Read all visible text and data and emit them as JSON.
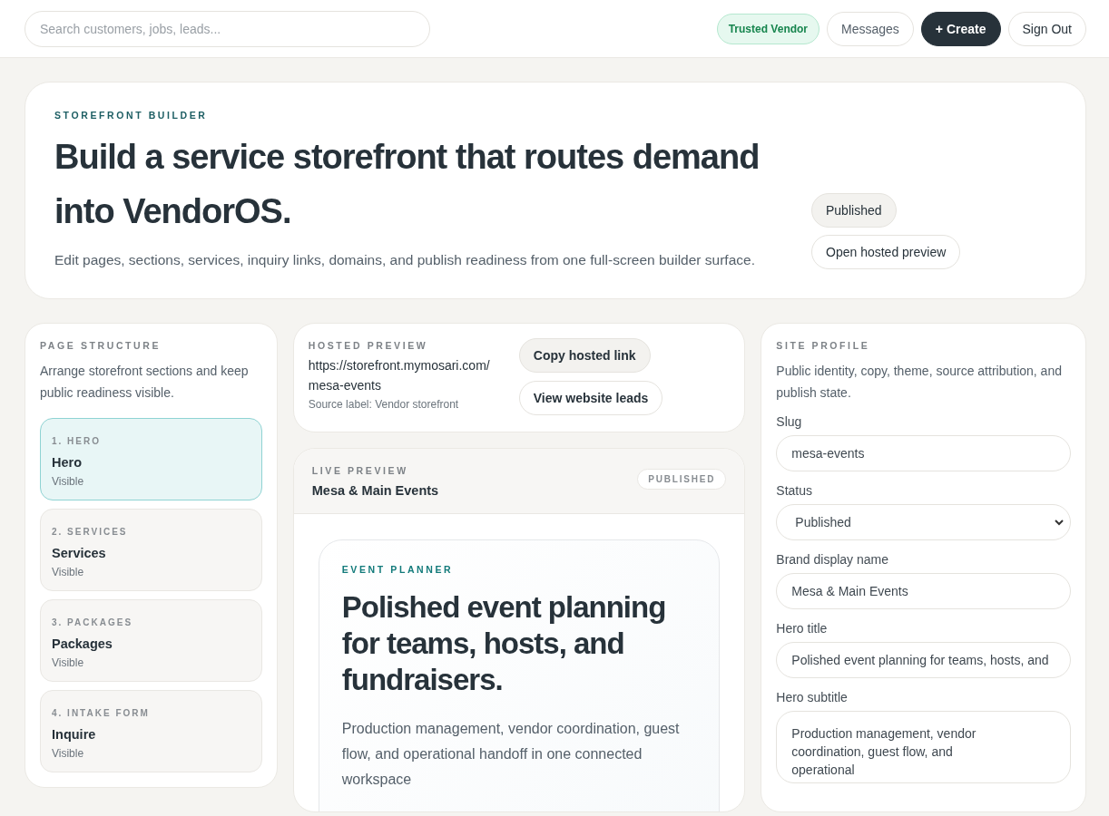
{
  "topbar": {
    "search": {
      "placeholder": "Search customers, jobs, leads..."
    },
    "badge": "Trusted Vendor",
    "buttons": [
      {
        "label": "Messages",
        "kind": "outline"
      },
      {
        "label": "+ Create",
        "kind": "primary"
      },
      {
        "label": "Sign Out",
        "kind": "outline"
      }
    ]
  },
  "hero": {
    "eyebrow": "STOREFRONT BUILDER",
    "title": "Build a service storefront that routes demand into VendorOS.",
    "description": "Edit pages, sections, services, inquiry links, domains, and publish readiness from one full-screen builder surface.",
    "status": "Published",
    "preview_button": "Open hosted preview"
  },
  "page_structure": {
    "heading": "PAGE STRUCTURE",
    "description": "Arrange storefront sections and keep public readiness visible.",
    "sections": [
      {
        "eyebrow": "1. HERO",
        "title": "Hero",
        "state": "Visible",
        "selected": true
      },
      {
        "eyebrow": "2. SERVICES",
        "title": "Services",
        "state": "Visible",
        "selected": false
      },
      {
        "eyebrow": "3. PACKAGES",
        "title": "Packages",
        "state": "Visible",
        "selected": false
      },
      {
        "eyebrow": "4. INTAKE FORM",
        "title": "Inquire",
        "state": "Visible",
        "selected": false
      }
    ]
  },
  "hosted_preview": {
    "heading": "HOSTED PREVIEW",
    "url": "https://storefront.mymosari.com/mesa-events",
    "source": "Source label: Vendor storefront",
    "buttons": [
      {
        "label": "Copy hosted link",
        "kind": "filled"
      },
      {
        "label": "View website leads",
        "kind": "outline"
      }
    ]
  },
  "live_preview": {
    "heading": "LIVE PREVIEW",
    "name": "Mesa & Main Events",
    "badge": "PUBLISHED",
    "eyebrow": "EVENT PLANNER",
    "title": "Polished event planning for teams, hosts, and fundraisers.",
    "subtitle": "Production management, vendor coordination, guest flow, and operational handoff in one connected workspace"
  },
  "site_profile": {
    "heading": "SITE PROFILE",
    "description": "Public identity, copy, theme, source attribution, and publish state.",
    "fields": [
      {
        "label": "Slug",
        "value": "mesa-events",
        "kind": "text"
      },
      {
        "label": "Status",
        "value": "Published",
        "kind": "select"
      },
      {
        "label": "Brand display name",
        "value": "Mesa & Main Events",
        "kind": "text"
      },
      {
        "label": "Hero title",
        "value": "Polished event planning for teams, hosts, and",
        "kind": "text"
      },
      {
        "label": "Hero subtitle",
        "value": "Production management, vendor coordination, guest flow, and operational",
        "kind": "textarea"
      }
    ]
  }
}
